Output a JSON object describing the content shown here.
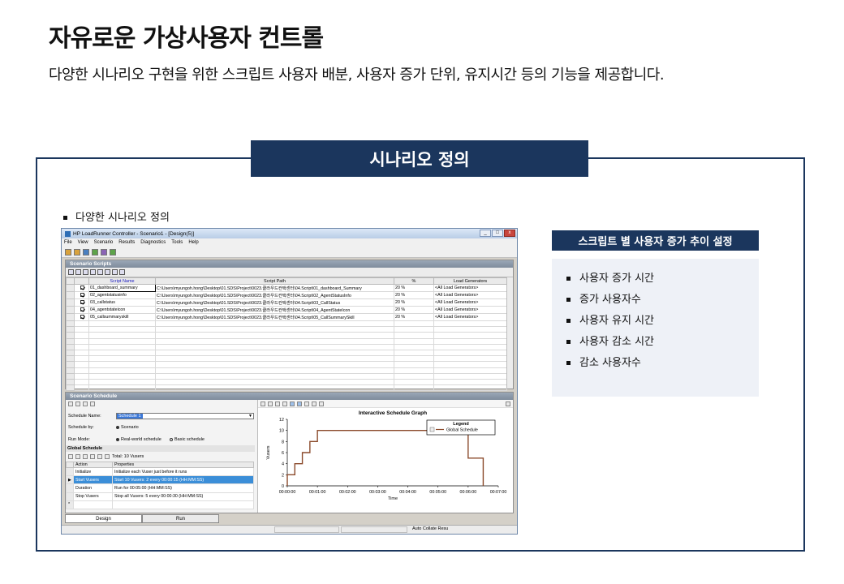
{
  "page": {
    "title": "자유로운 가상사용자 컨트롤",
    "subtitle": "다양한 시나리오 구현을 위한 스크립트 사용자 배분, 사용자 증가 단위, 유지시간 등의 기능을 제공합니다.",
    "section_title": "시나리오 정의",
    "bullet": "다양한 시나리오 정의"
  },
  "side": {
    "heading": "스크립트 별 사용자 증가 추이 설정",
    "items": [
      "사용자 증가 시간",
      "증가 사용자수",
      "사용자 유지 시간",
      "사용자 감소 시간",
      "감소 사용자수"
    ]
  },
  "window": {
    "title": "HP LoadRunner Controller - Scenario1 - [Design(5)]",
    "controls": [
      "_",
      "□",
      "x"
    ],
    "menu": [
      "File",
      "View",
      "Scenario",
      "Results",
      "Diagnostics",
      "Tools",
      "Help"
    ],
    "scripts_panel": {
      "header": "Scenario Scripts",
      "columns": [
        "Script Name",
        "Script Path",
        "%",
        "Load Generators"
      ],
      "rows": [
        {
          "name": "01_dashboard_summary",
          "path": "C:\\Users\\myungoh.hong\\Desktop\\01.SDS\\Project\\0023.클라우드컨택센터\\04.Script\\01_dashboard_Summary",
          "pct": "20 %",
          "lg": "<All Load Generators>"
        },
        {
          "name": "02_agentstatusinfo",
          "path": "C:\\Users\\myungoh.hong\\Desktop\\01.SDS\\Project\\0023.클라우드컨택센터\\04.Script\\02_AgentStatusInfo",
          "pct": "20 %",
          "lg": "<All Load Generators>"
        },
        {
          "name": "03_callstatus",
          "path": "C:\\Users\\myungoh.hong\\Desktop\\01.SDS\\Project\\0023.클라우드컨택센터\\04.Script\\03_CallStatus",
          "pct": "20 %",
          "lg": "<All Load Generators>"
        },
        {
          "name": "04_agentstateicon",
          "path": "C:\\Users\\myungoh.hong\\Desktop\\01.SDS\\Project\\0023.클라우드컨택센터\\04.Script\\04_AgentStateIcon",
          "pct": "20 %",
          "lg": "<All Load Generators>"
        },
        {
          "name": "05_callsummaryskill",
          "path": "C:\\Users\\myungoh.hong\\Desktop\\01.SDS\\Project\\0023.클라우드컨택센터\\04.Script\\05_CallSummarySkill",
          "pct": "20 %",
          "lg": "<All Load Generators>"
        }
      ]
    },
    "schedule_panel": {
      "header": "Scenario Schedule",
      "schedule_name_label": "Schedule Name:",
      "schedule_name_value": "Schedule 1",
      "schedule_by_label": "Schedule by:",
      "schedule_by_value": "Scenario",
      "run_mode_label": "Run Mode:",
      "run_mode_real": "Real-world schedule",
      "run_mode_basic": "Basic schedule",
      "global_header": "Global Schedule",
      "total": "Total: 10 Vusers",
      "columns": [
        "Action",
        "Properties"
      ],
      "rows": [
        {
          "action": "Initialize",
          "props": "Initialize each Vuser just before it runs"
        },
        {
          "action": "Start  Vusers",
          "props": "Start 10 Vusers: 2 every 00:00:15 (HH:MM:SS)"
        },
        {
          "action": "Duration",
          "props": "Run for 00:05:00 (HH:MM:SS)"
        },
        {
          "action": "Stop Vusers",
          "props": "Stop all Vusers: 5 every 00:00:30 (HH:MM:SS)"
        }
      ],
      "new_row_marker": "*"
    },
    "tabs": [
      "Design",
      "Run"
    ],
    "status": "Auto Collate Resu"
  },
  "chart_data": {
    "type": "line",
    "title": "Interactive Schedule Graph",
    "xlabel": "Time",
    "ylabel": "Vusers",
    "x_ticks": [
      "00:00:00",
      "00:01:00",
      "00:02:00",
      "00:03:00",
      "00:04:00",
      "00:05:00",
      "00:06:00",
      "00:07:00"
    ],
    "y_ticks": [
      0,
      2,
      4,
      6,
      8,
      10,
      12
    ],
    "xlim_seconds": [
      0,
      420
    ],
    "ylim": [
      0,
      12
    ],
    "legend_title": "Legend",
    "legend_position": "top-right",
    "series": [
      {
        "name": "Global Schedule",
        "color": "#8b4a2b",
        "points_seconds": [
          [
            0,
            0
          ],
          [
            0,
            2
          ],
          [
            15,
            2
          ],
          [
            15,
            4
          ],
          [
            30,
            4
          ],
          [
            30,
            6
          ],
          [
            45,
            6
          ],
          [
            45,
            8
          ],
          [
            60,
            8
          ],
          [
            60,
            10
          ],
          [
            360,
            10
          ],
          [
            360,
            5
          ],
          [
            390,
            5
          ],
          [
            390,
            0
          ]
        ]
      }
    ]
  }
}
